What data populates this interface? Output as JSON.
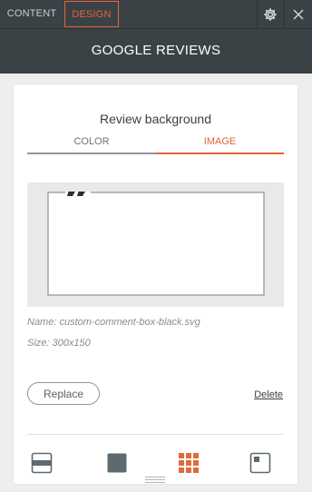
{
  "tabs": [
    {
      "label": "CONTENT",
      "active": false
    },
    {
      "label": "DESIGN",
      "active": true
    }
  ],
  "icons": {
    "settings": "gear-icon",
    "close": "close-icon"
  },
  "header": {
    "title": "GOOGLE REVIEWS"
  },
  "panel": {
    "section_title": "Review background",
    "subtabs": [
      {
        "label": "COLOR",
        "active": false
      },
      {
        "label": "IMAGE",
        "active": true
      }
    ],
    "image": {
      "name": "Name: custom-comment-box-black.svg",
      "size": "Size: 300x150"
    },
    "replace_label": "Replace",
    "delete_label": "Delete",
    "layout_options": [
      {
        "icon": "layout-banner-icon",
        "selected": false
      },
      {
        "icon": "layout-solid-icon",
        "selected": false
      },
      {
        "icon": "layout-tile-icon",
        "selected": true
      },
      {
        "icon": "layout-corner-icon",
        "selected": false
      }
    ]
  },
  "colors": {
    "accent": "#e8623a",
    "header_bg": "#3a4246",
    "panel_bg": "#eeeeee",
    "card_bg": "#ffffff",
    "muted": "#8e969a",
    "tile_color": "#e06a3c",
    "solid_color": "#5d6a70"
  }
}
